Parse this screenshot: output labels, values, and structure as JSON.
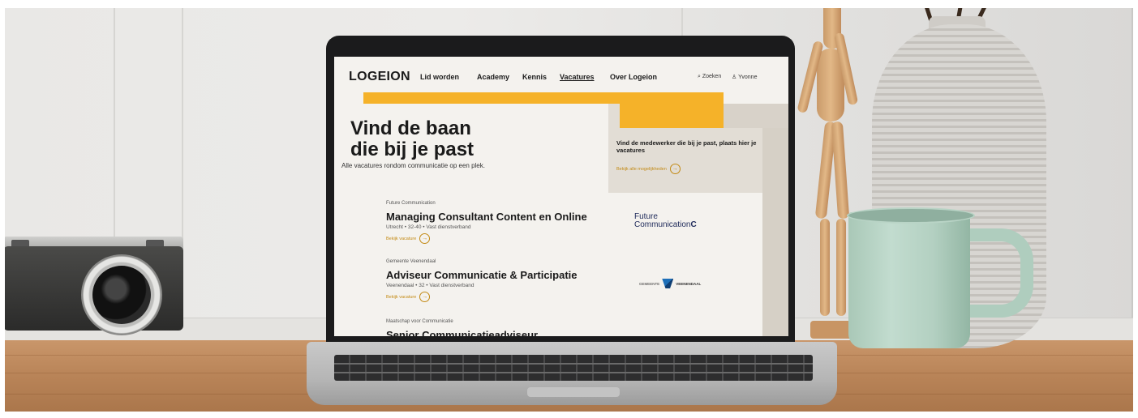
{
  "site": {
    "logo": "LOGEION",
    "nav": [
      "Lid worden",
      "Academy",
      "Kennis",
      "Vacatures",
      "Over Logeion"
    ],
    "active_nav": "Vacatures",
    "search_label": "Zoeken",
    "user_label": "Yvonne",
    "icons": [
      "search-icon",
      "user-icon",
      "arrow-circle-icon"
    ],
    "accent_color": "#f5b229",
    "link_color": "#c38a14"
  },
  "hero": {
    "title_line1": "Vind de baan",
    "title_line2": "die bij je past",
    "subtitle": "Alle vacatures rondom communicatie op een plek."
  },
  "employer_box": {
    "text": "Vind de medewerker die bij je past, plaats hier je vacatures",
    "link": "Bekijk alle mogelijkheden"
  },
  "jobs": [
    {
      "company": "Future Communication",
      "title": "Managing Consultant Content en Online",
      "meta": "Utrecht  •  32-40  •  Vast dienstverband",
      "link": "Bekijk vacature",
      "logo_line1": "Future",
      "logo_line2": "Communication",
      "logo_mark": "C"
    },
    {
      "company": "Gemeente Veenendaal",
      "title": "Adviseur Communicatie & Participatie",
      "meta": "Veenendaal  •  32  •  Vast dienstverband",
      "link": "Bekijk vacature",
      "logo_line1": "GEMEENTE",
      "logo_line2": "VEENENDAAL"
    },
    {
      "company": "Maatschap voor Communicatie",
      "title": "Senior Communicatieadviseur"
    }
  ]
}
